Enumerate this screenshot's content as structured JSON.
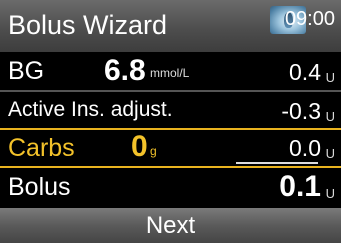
{
  "header": {
    "title": "Bolus Wizard",
    "time": "09:00"
  },
  "rows": {
    "bg": {
      "label": "BG",
      "value": "6.8",
      "value_unit": "mmol/L",
      "amount": "0.4",
      "unit": "U"
    },
    "active": {
      "label": "Active Ins. adjust.",
      "amount": "-0.3",
      "unit": "U"
    },
    "carbs": {
      "label": "Carbs",
      "value": "0",
      "value_unit": "g",
      "amount": "0.0",
      "unit": "U"
    },
    "bolus": {
      "label": "Bolus",
      "amount": "0.1",
      "unit": "U"
    }
  },
  "footer": {
    "next_label": "Next"
  },
  "colors": {
    "highlight": "#f3c22a",
    "background": "#000000"
  },
  "icons": {
    "header_icon": "water-drop-icon"
  }
}
